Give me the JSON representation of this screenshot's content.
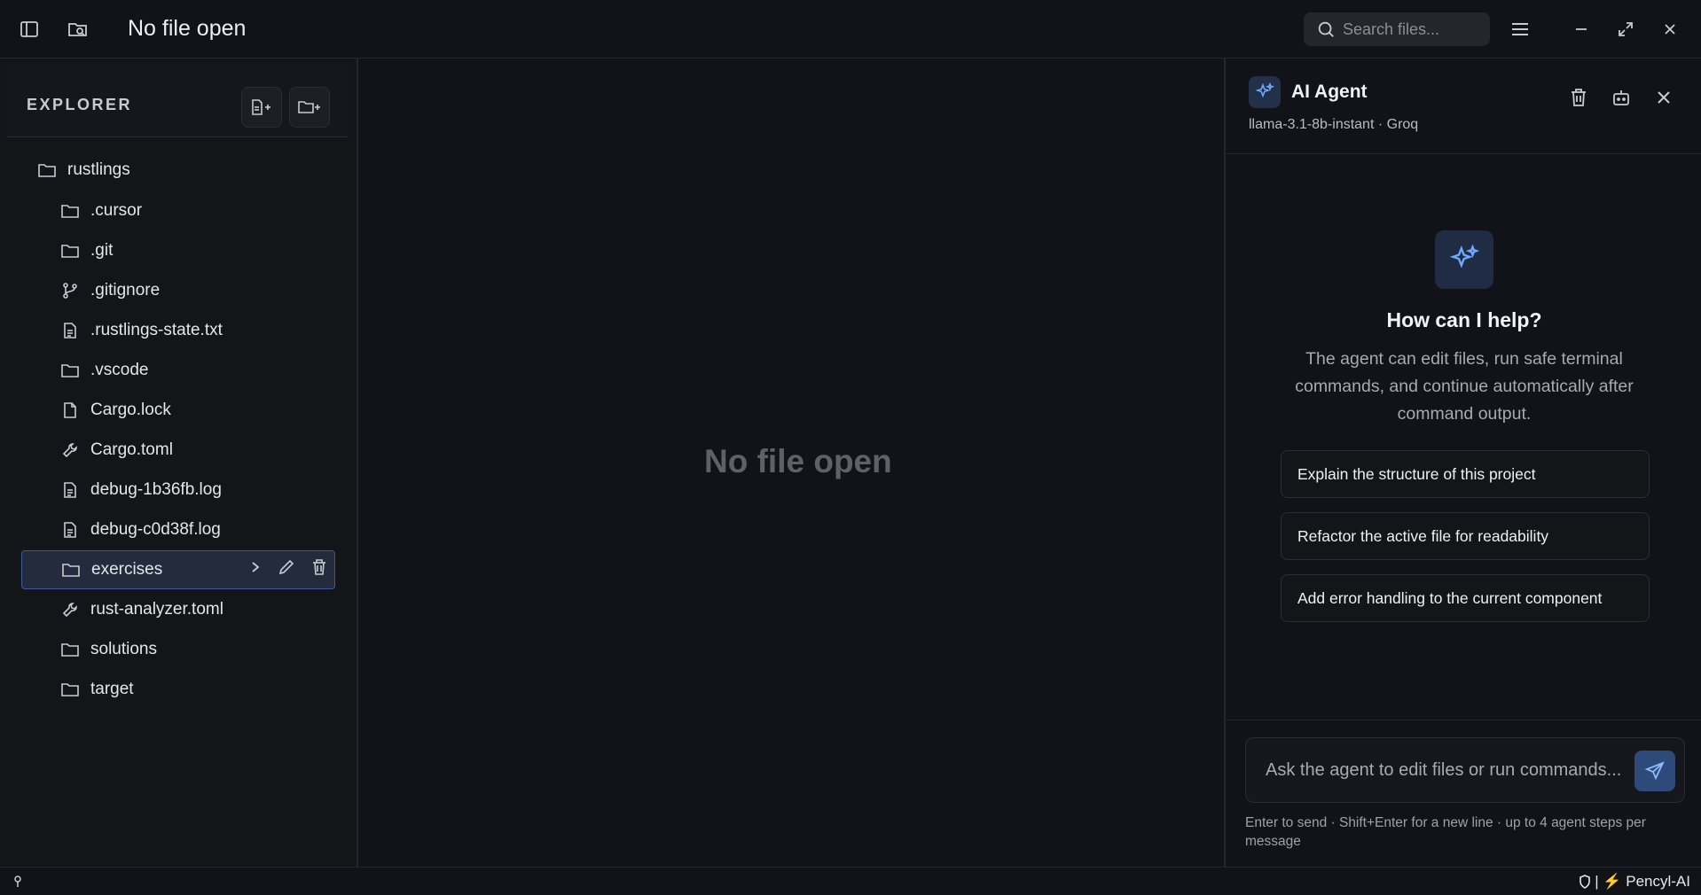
{
  "titlebar": {
    "title": "No file open",
    "search_placeholder": "Search files..."
  },
  "sidebar": {
    "title": "EXPLORER",
    "root": "rustlings",
    "items": [
      {
        "label": ".cursor",
        "icon": "folder-icon"
      },
      {
        "label": ".git",
        "icon": "folder-icon"
      },
      {
        "label": ".gitignore",
        "icon": "git-branch-icon"
      },
      {
        "label": ".rustlings-state.txt",
        "icon": "file-text-icon"
      },
      {
        "label": ".vscode",
        "icon": "folder-icon"
      },
      {
        "label": "Cargo.lock",
        "icon": "file-icon"
      },
      {
        "label": "Cargo.toml",
        "icon": "wrench-icon"
      },
      {
        "label": "debug-1b36fb.log",
        "icon": "file-text-icon"
      },
      {
        "label": "debug-c0d38f.log",
        "icon": "file-text-icon"
      },
      {
        "label": "exercises",
        "icon": "folder-icon",
        "selected": true
      },
      {
        "label": "rust-analyzer.toml",
        "icon": "wrench-icon"
      },
      {
        "label": "solutions",
        "icon": "folder-icon"
      },
      {
        "label": "target",
        "icon": "folder-icon"
      }
    ]
  },
  "editor": {
    "empty_text": "No file open"
  },
  "agent": {
    "title": "AI Agent",
    "model": "llama-3.1-8b-instant · Groq",
    "hero_title": "How can I help?",
    "hero_desc": "The agent can edit files, run safe terminal commands, and continue automatically after command output.",
    "suggestions": [
      "Explain the structure of this project",
      "Refactor the active file for readability",
      "Add error handling to the current component"
    ],
    "input_placeholder": "Ask the agent to edit files or run commands...",
    "hint": "Enter to send · Shift+Enter for a new line · up to 4 agent steps per message"
  },
  "statusbar": {
    "right_text": "| ⚡ Pencyl-AI"
  },
  "colors": {
    "background": "#111318",
    "accent": "#4a90e2",
    "selected_bg": "#242b3d"
  }
}
